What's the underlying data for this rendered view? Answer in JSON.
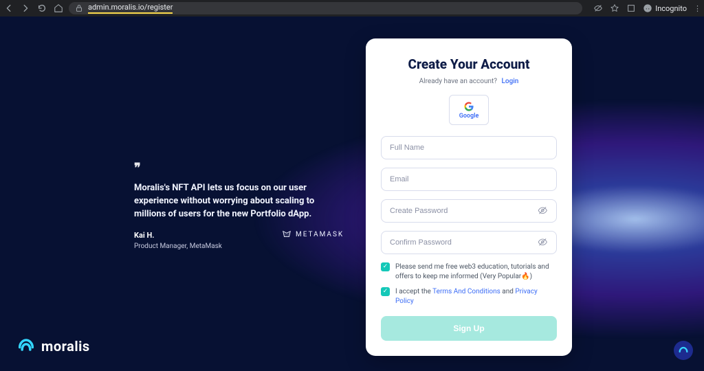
{
  "browser": {
    "url": "admin.moralis.io/register",
    "incognito_label": "Incognito"
  },
  "testimonial": {
    "quote": "Moralis's NFT API lets us focus on our user experience without worrying about scaling to millions of users for the new Portfolio dApp.",
    "author": "Kai H.",
    "author_title": "Product Manager, MetaMask",
    "partner_label": "METAMASK"
  },
  "logo": {
    "word": "moralis"
  },
  "form": {
    "title": "Create Your Account",
    "subtitle_text": "Already have an account?",
    "subtitle_link": "Login",
    "google_label": "Google",
    "fields": {
      "full_name_placeholder": "Full Name",
      "email_placeholder": "Email",
      "password_placeholder": "Create Password",
      "confirm_placeholder": "Confirm Password"
    },
    "check1_prefix": "Please send me free web3 education, tutorials and offers to keep me informed (Very Popular",
    "check1_suffix": ")",
    "check2_prefix": "I accept the",
    "check2_terms": "Terms And Conditions",
    "check2_and": " and ",
    "check2_privacy": "Privacy Policy",
    "submit_label": "Sign Up"
  }
}
